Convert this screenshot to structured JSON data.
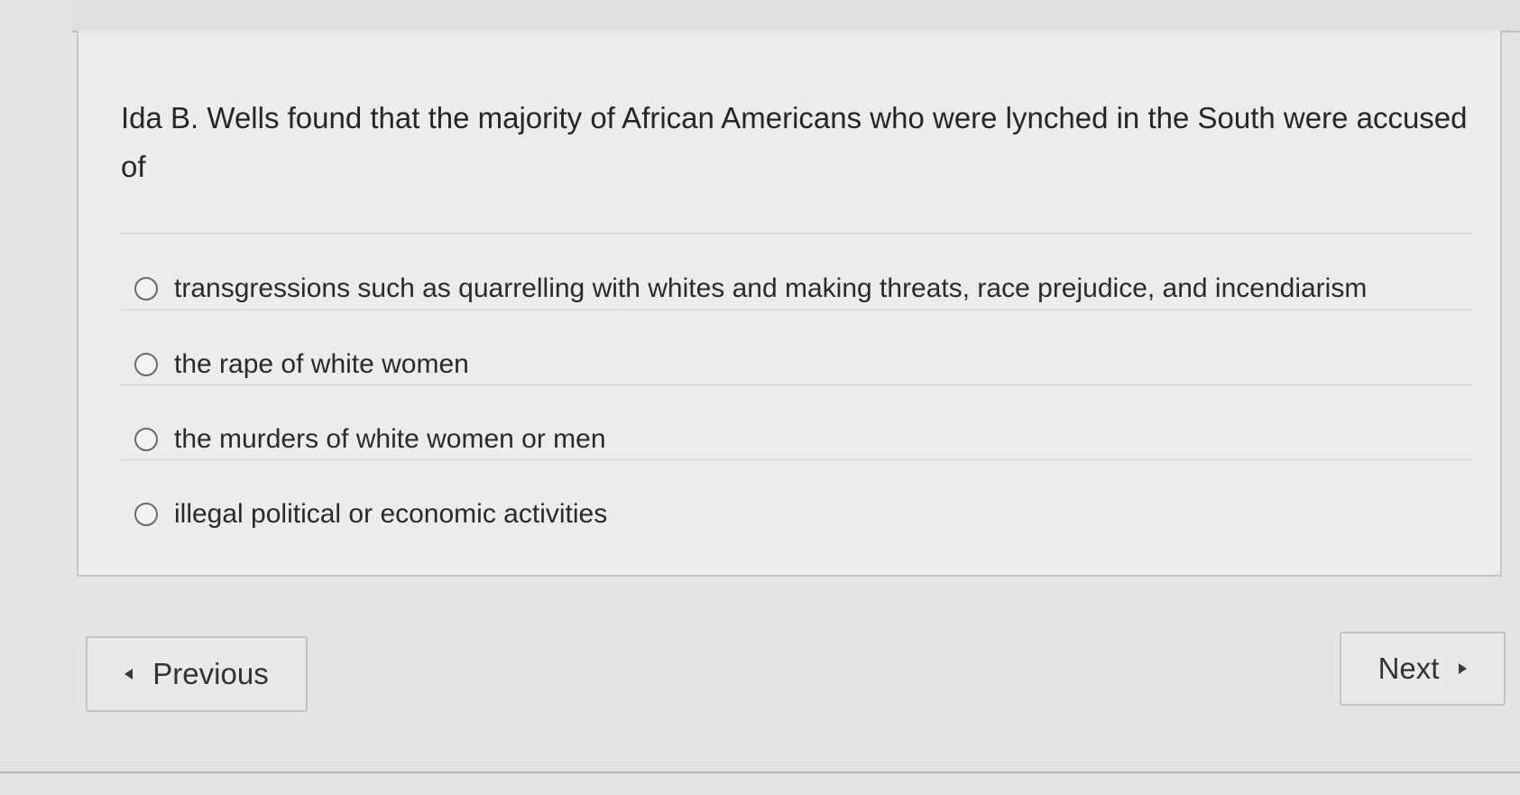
{
  "question": {
    "text": "Ida B. Wells found that the majority of African Americans who were lynched in the South were accused of"
  },
  "options": [
    {
      "label": "transgressions such as quarrelling with whites and making threats, race prejudice, and incendiarism",
      "selected": false
    },
    {
      "label": "the rape of white women",
      "selected": false
    },
    {
      "label": "the murders of white women or men",
      "selected": false
    },
    {
      "label": "illegal political or economic activities",
      "selected": false
    }
  ],
  "navigation": {
    "previous_label": "Previous",
    "next_label": "Next"
  },
  "icons": {
    "previous": "caret-left-icon",
    "next": "caret-right-icon",
    "option": "radio-button-icon"
  }
}
